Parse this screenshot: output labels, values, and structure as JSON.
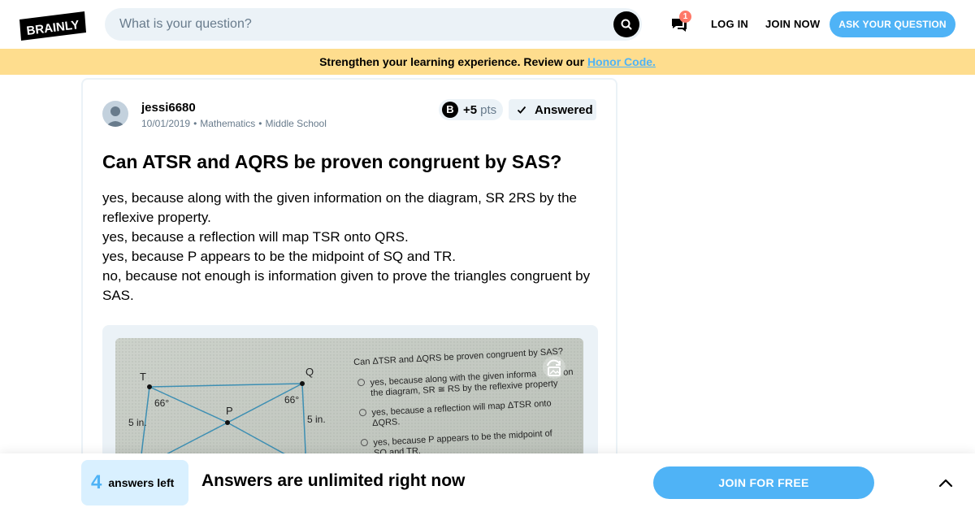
{
  "header": {
    "logo_text": "BRAINLY",
    "search_placeholder": "What is your question?",
    "messages_badge": "1",
    "login_label": "LOG IN",
    "join_label": "JOIN NOW",
    "ask_label": "ASK YOUR QUESTION"
  },
  "banner": {
    "text": "Strengthen your learning experience. Review our ",
    "link": "Honor Code."
  },
  "question": {
    "author": "jessi6680",
    "date": "10/01/2019",
    "subject": "Mathematics",
    "level": "Middle School",
    "points_value": "+5",
    "points_unit": "pts",
    "status": "Answered",
    "title": "Can ATSR and AQRS be proven congruent by SAS?",
    "body": [
      "yes, because along with the given information on the diagram, SR 2RS by the reflexive property.",
      "yes, because a reflection will map TSR onto QRS.",
      "yes, because P appears to be the midpoint of SQ and TR.",
      "no, because not enough is information given to prove the triangles congruent by SAS."
    ],
    "image": {
      "question_text": "Can ΔTSR and ΔQRS be proven congruent by SAS?",
      "option1_line1": "yes, because along with the given informa",
      "option1_line2": "the diagram, SR ≅ RS by the reflexive property",
      "option1_end": "on",
      "option2_line1": "yes, because a reflection will map ΔTSR onto",
      "option2_line2": "ΔQRS.",
      "option3_line1": "yes, because P appears to be the midpoint of",
      "option3_line2": "SQ and TR.",
      "label_T": "T",
      "label_Q": "Q",
      "label_P": "P",
      "angle_left": "66°",
      "angle_right": "66°",
      "side_left": "5 in.",
      "side_right": "5 in."
    }
  },
  "footer": {
    "answers_count": "4",
    "answers_label": "answers left",
    "headline": "Answers are unlimited right now",
    "cta": "JOIN FOR FREE"
  },
  "colors": {
    "accent": "#4fb3f6",
    "banner": "#fedd8e",
    "light": "#ebf2f7"
  }
}
